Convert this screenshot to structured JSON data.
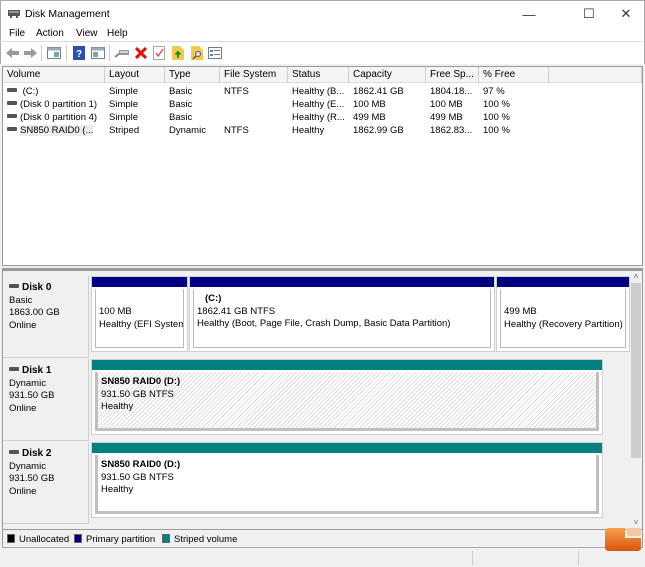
{
  "window": {
    "title": "Disk Management",
    "minimize_glyph": "—",
    "maximize_glyph": "☐",
    "close_glyph": "✕"
  },
  "menu": [
    "File",
    "Action",
    "View",
    "Help"
  ],
  "toolbar": {
    "icons": [
      "back-icon",
      "forward-icon",
      "show-hide-console-tree-icon",
      "help-icon",
      "properties-pane-icon",
      "connect-disk-icon",
      "delete-icon",
      "check-icon",
      "up-folder-icon",
      "search-folder-icon",
      "list-view-icon"
    ]
  },
  "volume_list": {
    "columns": [
      "Volume",
      "Layout",
      "Type",
      "File System",
      "Status",
      "Capacity",
      "Free Sp...",
      "% Free"
    ],
    "rows": [
      {
        "volume": " (C:)",
        "layout": "Simple",
        "type": "Basic",
        "fs": "NTFS",
        "status": "Healthy (B...",
        "capacity": "1862.41 GB",
        "free": "1804.18...",
        "pct": "97 %"
      },
      {
        "volume": "(Disk 0 partition 1)",
        "layout": "Simple",
        "type": "Basic",
        "fs": "",
        "status": "Healthy (E...",
        "capacity": "100 MB",
        "free": "100 MB",
        "pct": "100 %"
      },
      {
        "volume": "(Disk 0 partition 4)",
        "layout": "Simple",
        "type": "Basic",
        "fs": "",
        "status": "Healthy (R...",
        "capacity": "499 MB",
        "free": "499 MB",
        "pct": "100 %"
      },
      {
        "volume": "SN850 RAID0 (...",
        "layout": "Striped",
        "type": "Dynamic",
        "fs": "NTFS",
        "status": "Healthy",
        "capacity": "1862.99 GB",
        "free": "1862.83...",
        "pct": "100 %"
      }
    ]
  },
  "disks": [
    {
      "name": "Disk 0",
      "kind": "Basic",
      "size": "1863.00 GB",
      "state": "Online",
      "partitions": [
        {
          "title": "",
          "size": "100 MB",
          "status": "Healthy (EFI System"
        },
        {
          "title": "(C:)",
          "size": "1862.41 GB NTFS",
          "status": "Healthy (Boot, Page File, Crash Dump, Basic Data Partition)"
        },
        {
          "title": "",
          "size": "499 MB",
          "status": "Healthy (Recovery Partition)"
        }
      ]
    },
    {
      "name": "Disk 1",
      "kind": "Dynamic",
      "size": "931.50 GB",
      "state": "Online",
      "partitions": [
        {
          "title": "SN850 RAID0  (D:)",
          "size": "931.50 GB NTFS",
          "status": "Healthy"
        }
      ]
    },
    {
      "name": "Disk 2",
      "kind": "Dynamic",
      "size": "931.50 GB",
      "state": "Online",
      "partitions": [
        {
          "title": "SN850 RAID0  (D:)",
          "size": "931.50 GB NTFS",
          "status": "Healthy"
        }
      ]
    }
  ],
  "legend": [
    {
      "label": "Unallocated",
      "color": "#000000"
    },
    {
      "label": "Primary partition",
      "color": "#000080"
    },
    {
      "label": "Striped volume",
      "color": "#008080"
    }
  ],
  "colors": {
    "primary": "#000080",
    "striped": "#008080"
  }
}
